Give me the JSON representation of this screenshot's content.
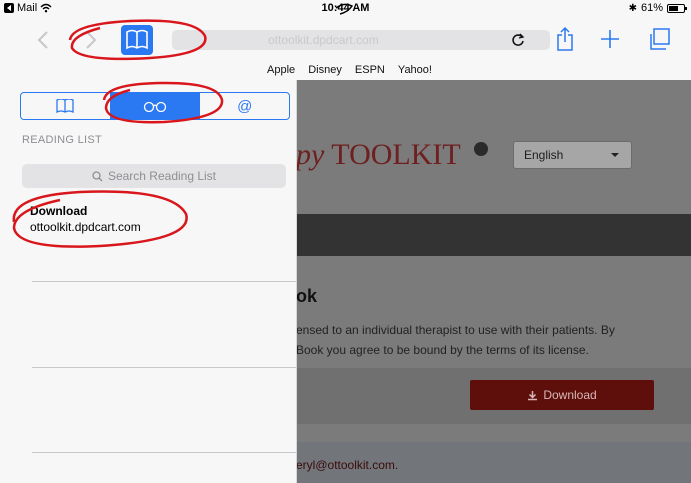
{
  "status_bar": {
    "app": "Mail",
    "time": "10:44 AM",
    "battery": "61%",
    "battery_level": 0.61
  },
  "toolbar": {
    "url_placeholder": "ottoolkit.dpdcart.com"
  },
  "bookmarks": [
    "Apple",
    "Disney",
    "ESPN",
    "Yahoo!"
  ],
  "sidebar": {
    "tabs": [
      {
        "name": "bookmarks",
        "icon": "book-icon",
        "active": false
      },
      {
        "name": "reading-list",
        "icon": "glasses-icon",
        "active": true
      },
      {
        "name": "shared-links",
        "icon": "at-icon",
        "active": false
      }
    ],
    "section_title": "READING LIST",
    "search_placeholder": "Search Reading List",
    "items": [
      {
        "title": "Download",
        "url": "ottoolkit.dpdcart.com"
      }
    ]
  },
  "webpage": {
    "logo_prefix": "py",
    "logo_brand": "TOOLKIT",
    "language": "English",
    "heading_fragment": "ok",
    "license_line1": "ensed to an individual therapist to use with their patients. By",
    "license_line2": "Book you agree to be bound by the terms of its license.",
    "download_label": "Download",
    "email_fragment": "eryl@ottoolkit.com."
  },
  "colors": {
    "accent": "#2b79f2",
    "annotation": "#d8161c",
    "download_button": "#5e0f0c",
    "logo": "#6e1f1f"
  }
}
